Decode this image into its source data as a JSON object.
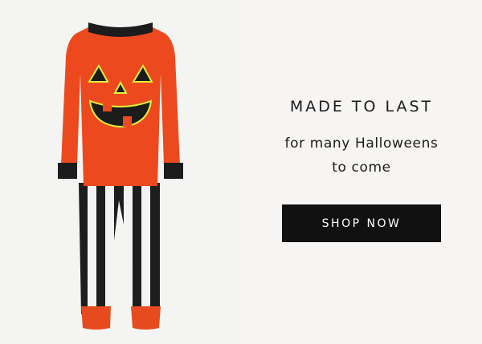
{
  "banner": {
    "image": {
      "subject": "jack-o-lantern pajama set",
      "colors": {
        "shirt": "#ec4a1e",
        "trim": "#1c1c1c",
        "face_outline": "#e4f13a",
        "stripe_light": "#f3f3f1",
        "stripe_dark": "#1d1d1d",
        "cuff": "#e64b1f",
        "background": "#f4f4f2"
      }
    },
    "headline": "MADE TO LAST",
    "subhead_line1": "for many Halloweens",
    "subhead_line2": "to come",
    "cta_label": "SHOP NOW"
  }
}
